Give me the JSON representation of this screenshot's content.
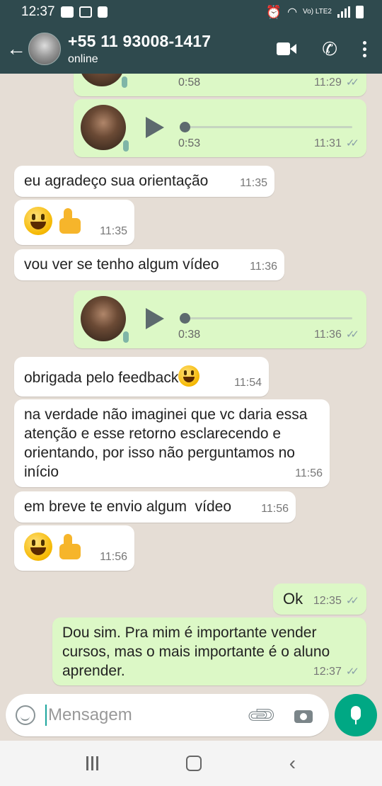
{
  "status_bar": {
    "time": "12:37",
    "network": "Vo) LTE2"
  },
  "header": {
    "contact_name": "+55 11 93008-1417",
    "contact_status": "online",
    "icons": [
      "back-arrow-icon",
      "video-call-icon",
      "phone-icon",
      "more-options-icon"
    ]
  },
  "messages": [
    {
      "dir": "out",
      "type": "voice",
      "duration": "0:58",
      "time": "11:29",
      "ticks": "✓✓"
    },
    {
      "dir": "out",
      "type": "voice",
      "duration": "0:53",
      "time": "11:31",
      "ticks": "✓✓"
    },
    {
      "dir": "in",
      "type": "text",
      "text": "eu agradeço sua orientação",
      "time": "11:35"
    },
    {
      "dir": "in",
      "type": "emoji",
      "emojis": [
        "grinning-face",
        "thumbs-up"
      ],
      "time": "11:35"
    },
    {
      "dir": "in",
      "type": "text",
      "text": "vou ver se tenho algum vídeo",
      "time": "11:36"
    },
    {
      "dir": "out",
      "type": "voice",
      "duration": "0:38",
      "time": "11:36",
      "ticks": "✓✓"
    },
    {
      "dir": "in",
      "type": "text",
      "text": "obrigada pelo feedback",
      "emoji": "grinning-face",
      "time": "11:54"
    },
    {
      "dir": "in",
      "type": "text",
      "text": "na verdade não imaginei que vc daria essa atenção e esse retorno esclarecendo e orientando, por isso não perguntamos no início",
      "time": "11:56"
    },
    {
      "dir": "in",
      "type": "text",
      "text": "em breve te envio algum  vídeo",
      "time": "11:56"
    },
    {
      "dir": "in",
      "type": "emoji",
      "emojis": [
        "grinning-face",
        "thumbs-up"
      ],
      "time": "11:56"
    },
    {
      "dir": "out",
      "type": "text",
      "text": "Ok",
      "time": "12:35",
      "ticks": "✓✓"
    },
    {
      "dir": "out",
      "type": "text",
      "text": "Dou sim. Pra mim é importante vender cursos, mas o mais importante é o aluno aprender.",
      "time": "12:37",
      "ticks": "✓✓"
    }
  ],
  "composer": {
    "placeholder": "Mensagem",
    "icons": [
      "emoji-icon",
      "attach-icon",
      "camera-icon",
      "mic-icon"
    ]
  },
  "colors": {
    "header": "#2f4a4e",
    "chat_background": "#e5ddd5",
    "outgoing_bubble": "#dcf8c6",
    "incoming_bubble": "#ffffff",
    "accent": "#00a884"
  }
}
